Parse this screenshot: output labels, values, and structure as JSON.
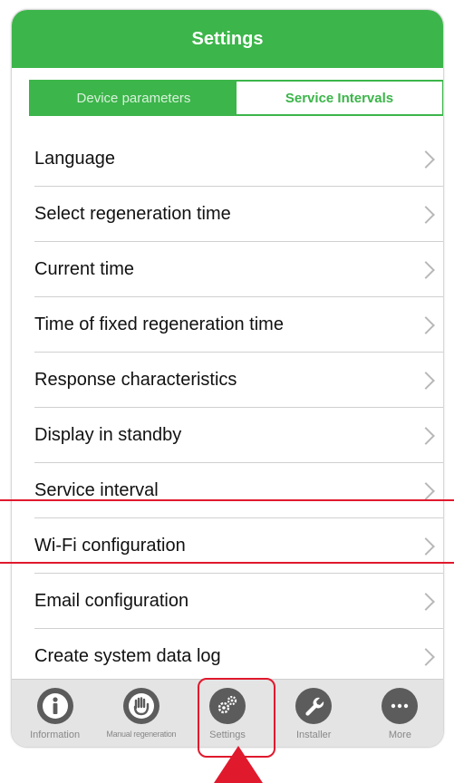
{
  "header": {
    "title": "Settings"
  },
  "segments": {
    "device": "Device parameters",
    "service": "Service Intervals"
  },
  "rows": [
    "Language",
    "Select regeneration time",
    "Current time",
    "Time of fixed regeneration time",
    "Response characteristics",
    "Display in standby",
    "Service interval",
    "Wi-Fi configuration",
    "Email configuration",
    "Create system data log"
  ],
  "tabs": {
    "information": "Information",
    "manual": "Manual regeneration",
    "settings": "Settings",
    "installer": "Installer",
    "more": "More"
  },
  "colors": {
    "accent": "#3cb54a",
    "annotation": "#e0192d"
  }
}
